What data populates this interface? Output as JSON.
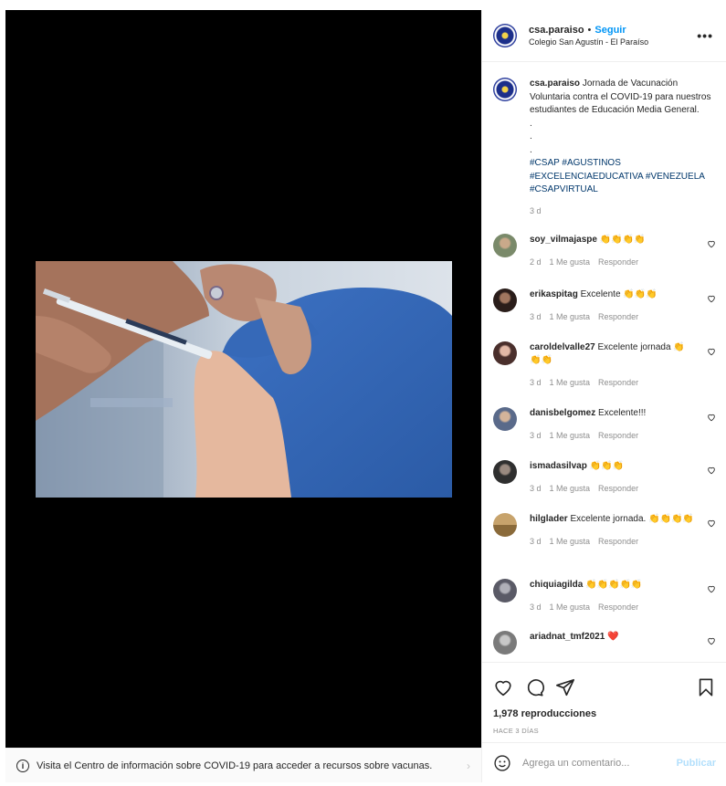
{
  "post": {
    "username": "csa.paraiso",
    "follow_label": "Seguir",
    "location": "Colegio San Agustín - El Paraíso",
    "more_label": "•••"
  },
  "caption": {
    "username": "csa.paraiso",
    "text": "Jornada de Vacunación Voluntaria contra el COVID-19 para nuestros estudiantes de Educación Media General.",
    "dots": [
      ".",
      ".",
      "."
    ],
    "hashtags": [
      "#CSAP",
      "#AGUSTINOS",
      "#EXCELENCIAEDUCATIVA",
      "#VENEZUELA",
      "#CSAPVIRTUAL"
    ],
    "age": "3 d"
  },
  "comments": [
    {
      "user": "soy_vilmajaspe",
      "text": "👏👏👏👏",
      "age": "2 d",
      "likes": "1 Me gusta",
      "reply": "Responder"
    },
    {
      "user": "erikaspitag",
      "text": "Excelente 👏👏👏",
      "age": "3 d",
      "likes": "1 Me gusta",
      "reply": "Responder"
    },
    {
      "user": "caroldelvalle27",
      "text": "Excelente jornada 👏👏👏",
      "age": "3 d",
      "likes": "1 Me gusta",
      "reply": "Responder"
    },
    {
      "user": "danisbelgomez",
      "text": "Excelente!!!",
      "age": "3 d",
      "likes": "1 Me gusta",
      "reply": "Responder"
    },
    {
      "user": "ismadasilvap",
      "text": "👏👏👏",
      "age": "3 d",
      "likes": "1 Me gusta",
      "reply": "Responder"
    },
    {
      "user": "hilglader",
      "text": "Excelente jornada. 👏👏👏👏",
      "age": "3 d",
      "likes": "1 Me gusta",
      "reply": "Responder"
    },
    {
      "user": "chiquiagilda",
      "text": "👏👏👏👏👏",
      "age": "3 d",
      "likes": "1 Me gusta",
      "reply": "Responder"
    },
    {
      "user": "ariadnat_tmf2021",
      "text": "❤️",
      "age": "",
      "likes": "",
      "reply": ""
    }
  ],
  "stats": {
    "views": "1,978 reproducciones",
    "posted": "HACE 3 DÍAS"
  },
  "add_comment": {
    "placeholder": "Agrega un comentario...",
    "publish_label": "Publicar"
  },
  "covid_banner": {
    "text": "Visita el Centro de información sobre COVID-19 para acceder a recursos sobre vacunas."
  },
  "colors": {
    "link_blue": "#0095f6",
    "hashtag_blue": "#00376b",
    "muted_gray": "#8e8e8e",
    "heart_red": "#ed4956"
  }
}
